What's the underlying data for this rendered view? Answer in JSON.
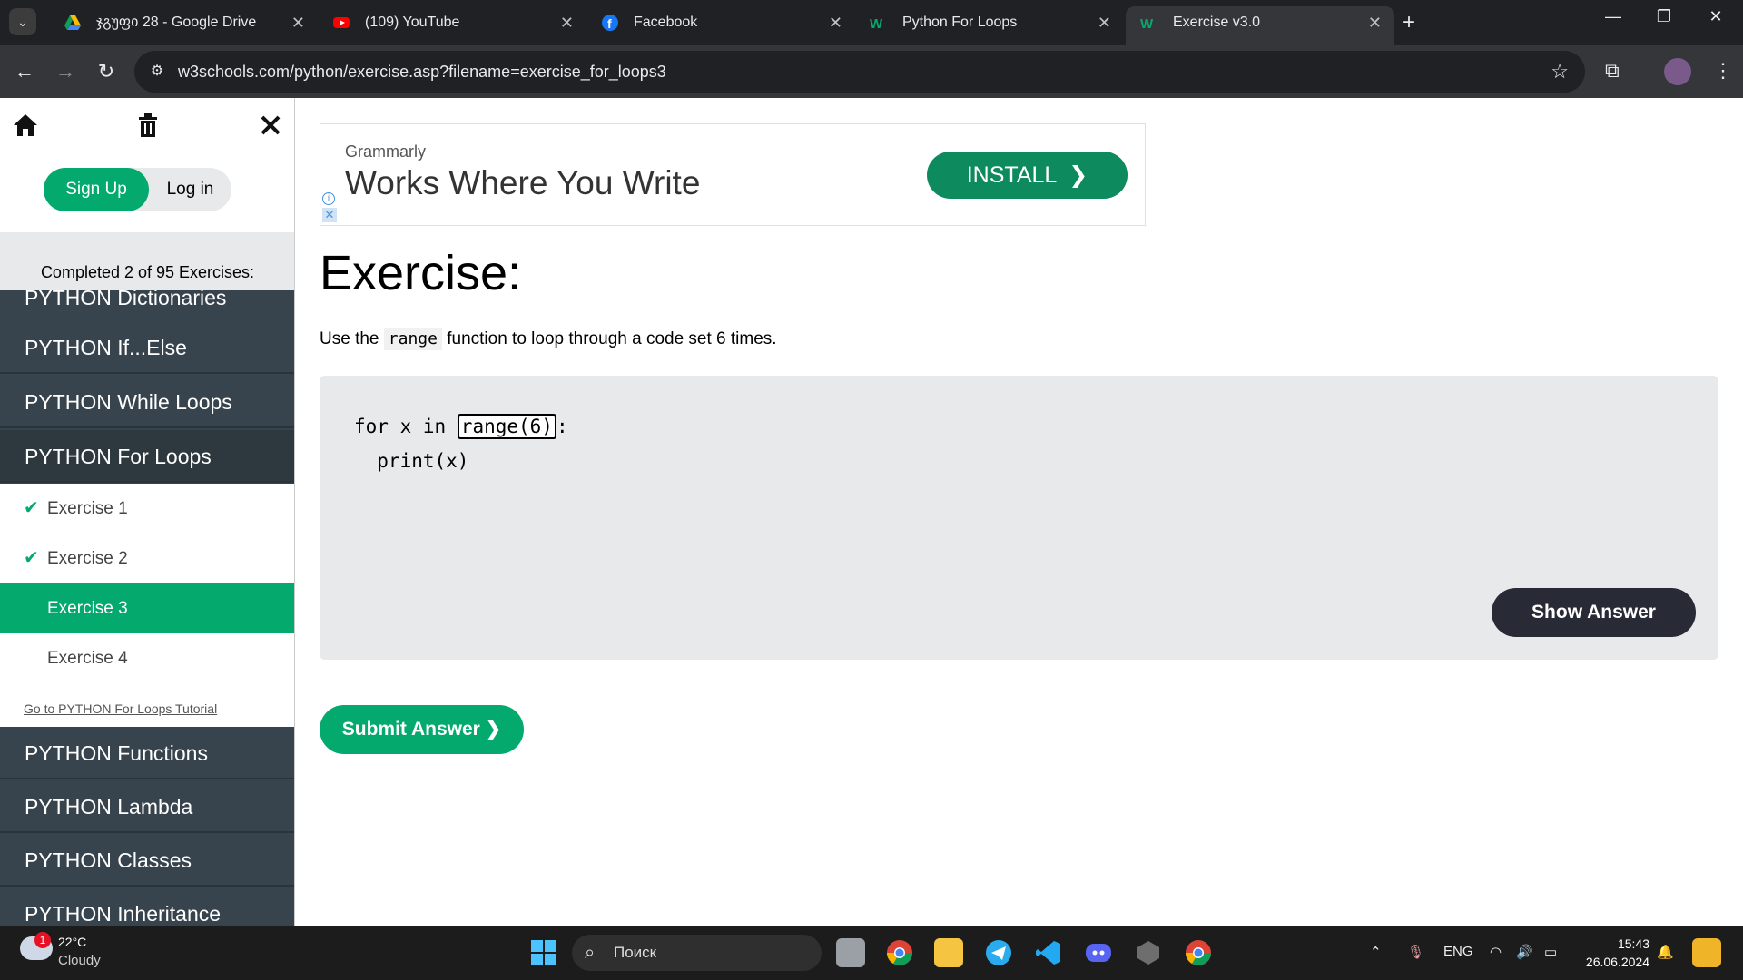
{
  "browser": {
    "tabs": [
      {
        "title": "ჯგუფი 28 - Google Drive",
        "icon": "google-drive-icon"
      },
      {
        "title": "(109) YouTube",
        "icon": "youtube-icon"
      },
      {
        "title": "Facebook",
        "icon": "facebook-icon"
      },
      {
        "title": "Python For Loops",
        "icon": "w3schools-icon"
      },
      {
        "title": "Exercise v3.0",
        "icon": "w3schools-icon",
        "active": true
      }
    ],
    "url": "w3schools.com/python/exercise.asp?filename=exercise_for_loops3"
  },
  "sidebar": {
    "signup_label": "Sign Up",
    "login_label": "Log in",
    "progress_text": "Completed 2 of 95 Exercises:",
    "categories_top": [
      "PYTHON Dictionaries",
      "PYTHON If...Else",
      "PYTHON While Loops",
      "PYTHON For Loops"
    ],
    "exercises": [
      {
        "label": "Exercise 1",
        "done": true
      },
      {
        "label": "Exercise 2",
        "done": true
      },
      {
        "label": "Exercise 3",
        "active": true
      },
      {
        "label": "Exercise 4"
      }
    ],
    "tutorial_link": "Go to PYTHON For Loops Tutorial",
    "categories_bottom": [
      "PYTHON Functions",
      "PYTHON Lambda",
      "PYTHON Classes",
      "PYTHON Inheritance"
    ]
  },
  "ad": {
    "brand": "Grammarly",
    "headline": "Works Where You Write",
    "cta": "INSTALL"
  },
  "exercise": {
    "title": "Exercise:",
    "instruction_before": "Use the",
    "instruction_code": "range",
    "instruction_after": "function to loop through a code set 6 times.",
    "code_prefix": "for x in ",
    "input_value": "range(6)",
    "code_suffix": ":",
    "code_line2": "  print(x)",
    "show_answer_label": "Show Answer",
    "submit_label": "Submit Answer ❯"
  },
  "taskbar": {
    "weather_temp": "22°C",
    "weather_desc": "Cloudy",
    "weather_badge": "1",
    "search_placeholder": "Поиск",
    "language": "ENG",
    "time": "15:43",
    "date": "26.06.2024"
  }
}
